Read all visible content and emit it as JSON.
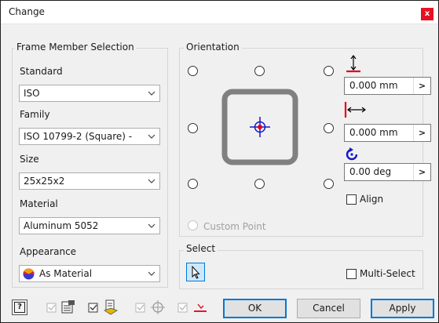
{
  "window": {
    "title": "Change",
    "close_label": "x"
  },
  "frame_member": {
    "group_title": "Frame Member Selection",
    "standard": {
      "label": "Standard",
      "value": "ISO"
    },
    "family": {
      "label": "Family",
      "value": "ISO 10799-2 (Square) -"
    },
    "size": {
      "label": "Size",
      "value": "25x25x2"
    },
    "material": {
      "label": "Material",
      "value": "Aluminum 5052"
    },
    "appearance": {
      "label": "Appearance",
      "value": "As Material"
    }
  },
  "orientation": {
    "group_title": "Orientation",
    "custom_point_label": "Custom Point",
    "vertical_offset": "0.000 mm",
    "horizontal_offset": "0.000 mm",
    "rotation": "0.00 deg",
    "align_label": "Align",
    "chevron": ">"
  },
  "select": {
    "group_title": "Select",
    "multi_select_label": "Multi-Select"
  },
  "footer": {
    "help_label": "?",
    "ok_label": "OK",
    "cancel_label": "Cancel",
    "apply_label": "Apply"
  },
  "colors": {
    "close_red": "#e81123",
    "accent_blue": "#0078d7",
    "marker_red": "#e0001b",
    "profile_gray": "#808080"
  }
}
